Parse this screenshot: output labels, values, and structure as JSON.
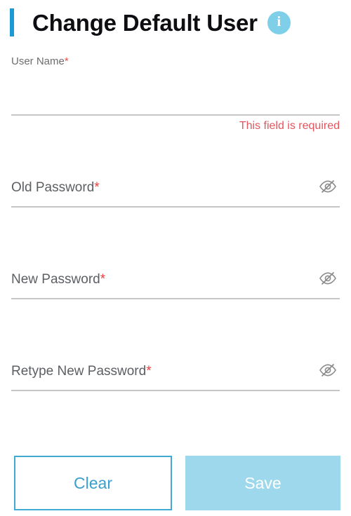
{
  "header": {
    "title": "Change Default User",
    "info_icon": "info-circle-icon",
    "info_letter": "i",
    "accent_color": "#1c9ad6",
    "info_badge_color": "#7fcfe8"
  },
  "form": {
    "fields": [
      {
        "id": "user-name",
        "label": "User Name",
        "required_marker": "*",
        "value": "",
        "placeholder": "",
        "error": "This field is required",
        "has_toggle": false,
        "state": "error"
      },
      {
        "id": "old-password",
        "label": "Old Password",
        "required_marker": "*",
        "value": "",
        "placeholder": "",
        "error": "",
        "has_toggle": true,
        "toggle_icon": "eye-off-icon",
        "state": "empty"
      },
      {
        "id": "new-password",
        "label": "New Password",
        "required_marker": "*",
        "value": "",
        "placeholder": "",
        "error": "",
        "has_toggle": true,
        "toggle_icon": "eye-off-icon",
        "state": "empty"
      },
      {
        "id": "retype-new-password",
        "label": "Retype New Password",
        "required_marker": "*",
        "value": "",
        "placeholder": "",
        "error": "",
        "has_toggle": true,
        "toggle_icon": "eye-off-icon",
        "state": "empty"
      }
    ]
  },
  "actions": {
    "clear_label": "Clear",
    "save_label": "Save",
    "clear_color": "#3a9fd0",
    "save_bg": "#9ed8ec",
    "save_enabled": false
  },
  "colors": {
    "error_text": "#e8545c",
    "required_star": "#ef3e3e",
    "underline": "#c6c6c6",
    "label": "#5c5f63",
    "title": "#0d0d12"
  }
}
